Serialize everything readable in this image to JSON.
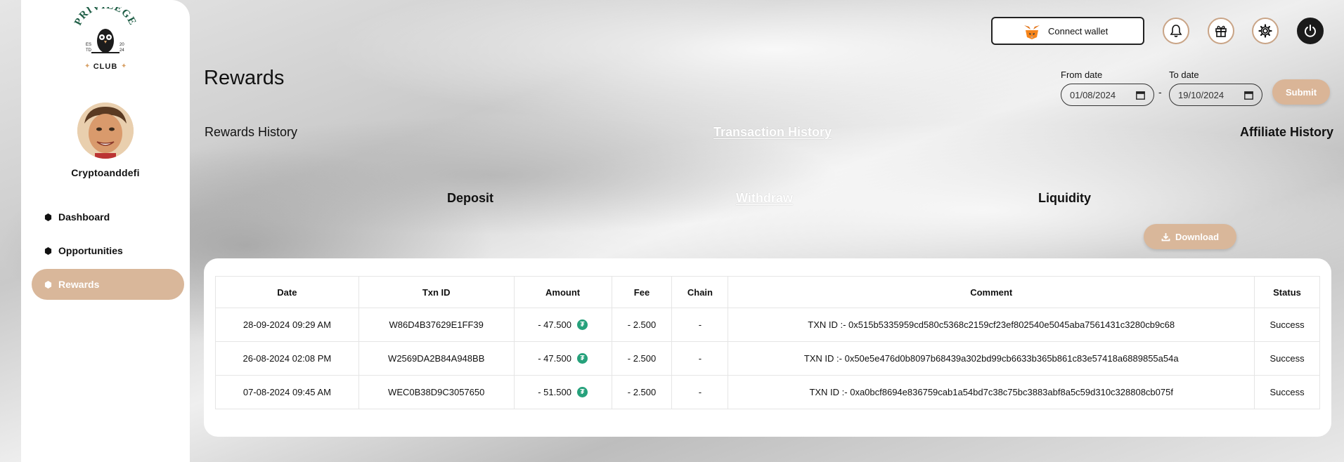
{
  "brand": {
    "logo_top": "PRIVILEGE",
    "logo_bottom": "CLUB",
    "est_left": "ES TD",
    "est_right": "20 24"
  },
  "user": {
    "name": "Cryptoanddefi"
  },
  "sidebar": {
    "items": [
      {
        "label": "Dashboard",
        "active": false
      },
      {
        "label": "Opportunities",
        "active": false
      },
      {
        "label": "Rewards",
        "active": true
      }
    ]
  },
  "header": {
    "connect_label": "Connect wallet",
    "icons": [
      "bell-icon",
      "gift-icon",
      "settings-icon",
      "power-icon"
    ]
  },
  "page": {
    "title": "Rewards"
  },
  "filters": {
    "from_label": "From date",
    "from_value": "01/08/2024",
    "separator": "-",
    "to_label": "To date",
    "to_value": "19/10/2024",
    "submit_label": "Submit"
  },
  "tabs": [
    {
      "label": "Rewards History",
      "active": false
    },
    {
      "label": "Transaction History",
      "active": true
    },
    {
      "label": "Affiliate History",
      "active": false
    }
  ],
  "subtabs": [
    {
      "label": "Deposit",
      "active": false
    },
    {
      "label": "Withdraw",
      "active": true
    },
    {
      "label": "Liquidity",
      "active": false
    }
  ],
  "download_label": "Download",
  "table": {
    "headers": [
      "Date",
      "Txn ID",
      "Amount",
      "Fee",
      "Chain",
      "Comment",
      "Status"
    ],
    "rows": [
      {
        "date": "28-09-2024 09:29 AM",
        "txn_id": "W86D4B37629E1FF39",
        "amount": "- 47.500",
        "fee": "- 2.500",
        "chain": "-",
        "comment": "TXN ID :- 0x515b5335959cd580c5368c2159cf23ef802540e5045aba7561431c3280cb9c68",
        "status": "Success"
      },
      {
        "date": "26-08-2024 02:08 PM",
        "txn_id": "W2569DA2B84A948BB",
        "amount": "- 47.500",
        "fee": "- 2.500",
        "chain": "-",
        "comment": "TXN ID :- 0x50e5e476d0b8097b68439a302bd99cb6633b365b861c83e57418a6889855a54a",
        "status": "Success"
      },
      {
        "date": "07-08-2024 09:45 AM",
        "txn_id": "WEC0B38D9C3057650",
        "amount": "- 51.500",
        "fee": "- 2.500",
        "chain": "-",
        "comment": "TXN ID :- 0xa0bcf8694e836759cab1a54bd7c38c75bc3883abf8a5c59d310c328808cb075f",
        "status": "Success"
      }
    ]
  },
  "colors": {
    "accent": "#d9b79a",
    "tether": "#26a17b",
    "logo_green": "#1f5e46"
  }
}
